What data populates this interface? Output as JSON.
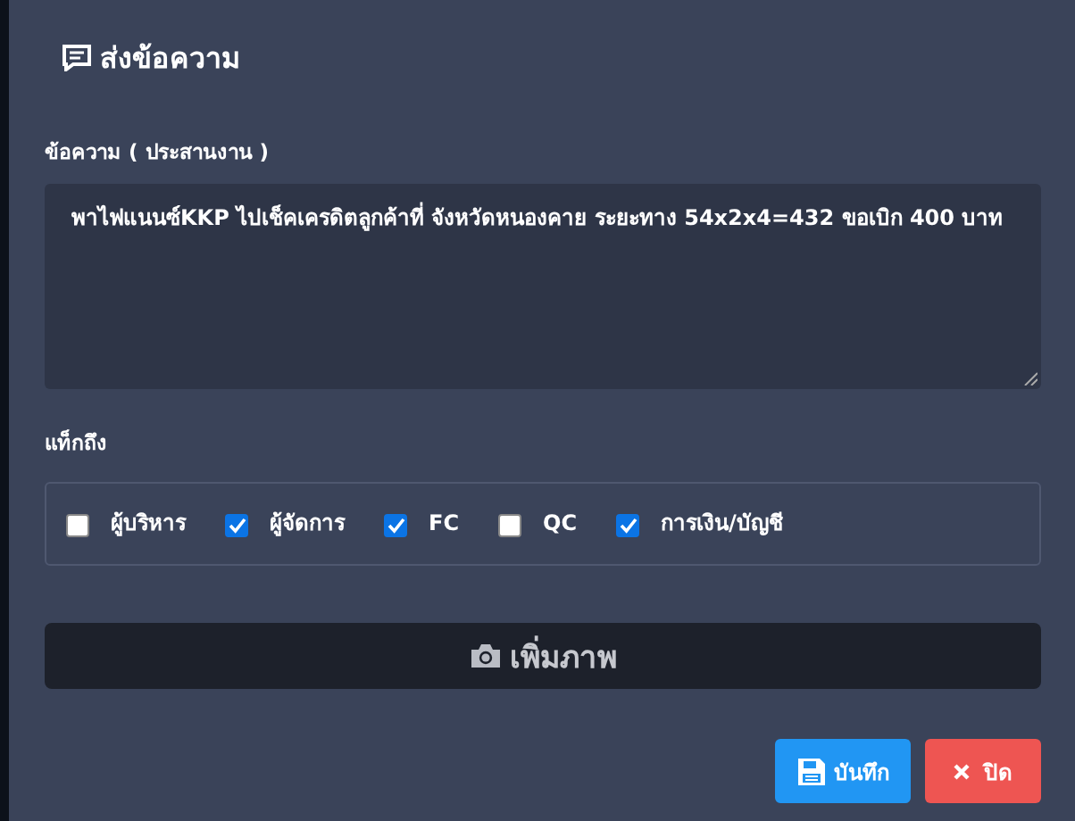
{
  "dialog": {
    "title": "ส่งข้อความ"
  },
  "message": {
    "label": "ข้อความ ( ประสานงาน )",
    "value": "พาไฟแนนซ์KKP ไปเช็คเครดิตลูกค้าที่ จังหวัดหนองคาย ระยะทาง 54x2x4=432 ขอเบิก 400 บาท"
  },
  "tags": {
    "label": "แท็กถึง",
    "options": [
      {
        "label": "ผู้บริหาร",
        "checked": false
      },
      {
        "label": "ผู้จัดการ",
        "checked": true
      },
      {
        "label": "FC",
        "checked": true
      },
      {
        "label": "QC",
        "checked": false
      },
      {
        "label": "การเงิน/บัญชี",
        "checked": true
      }
    ]
  },
  "add_image_button": "เพิ่มภาพ",
  "buttons": [
    {
      "kind": "save",
      "label": "บันทึก"
    },
    {
      "kind": "close",
      "label": "ปิด"
    }
  ]
}
